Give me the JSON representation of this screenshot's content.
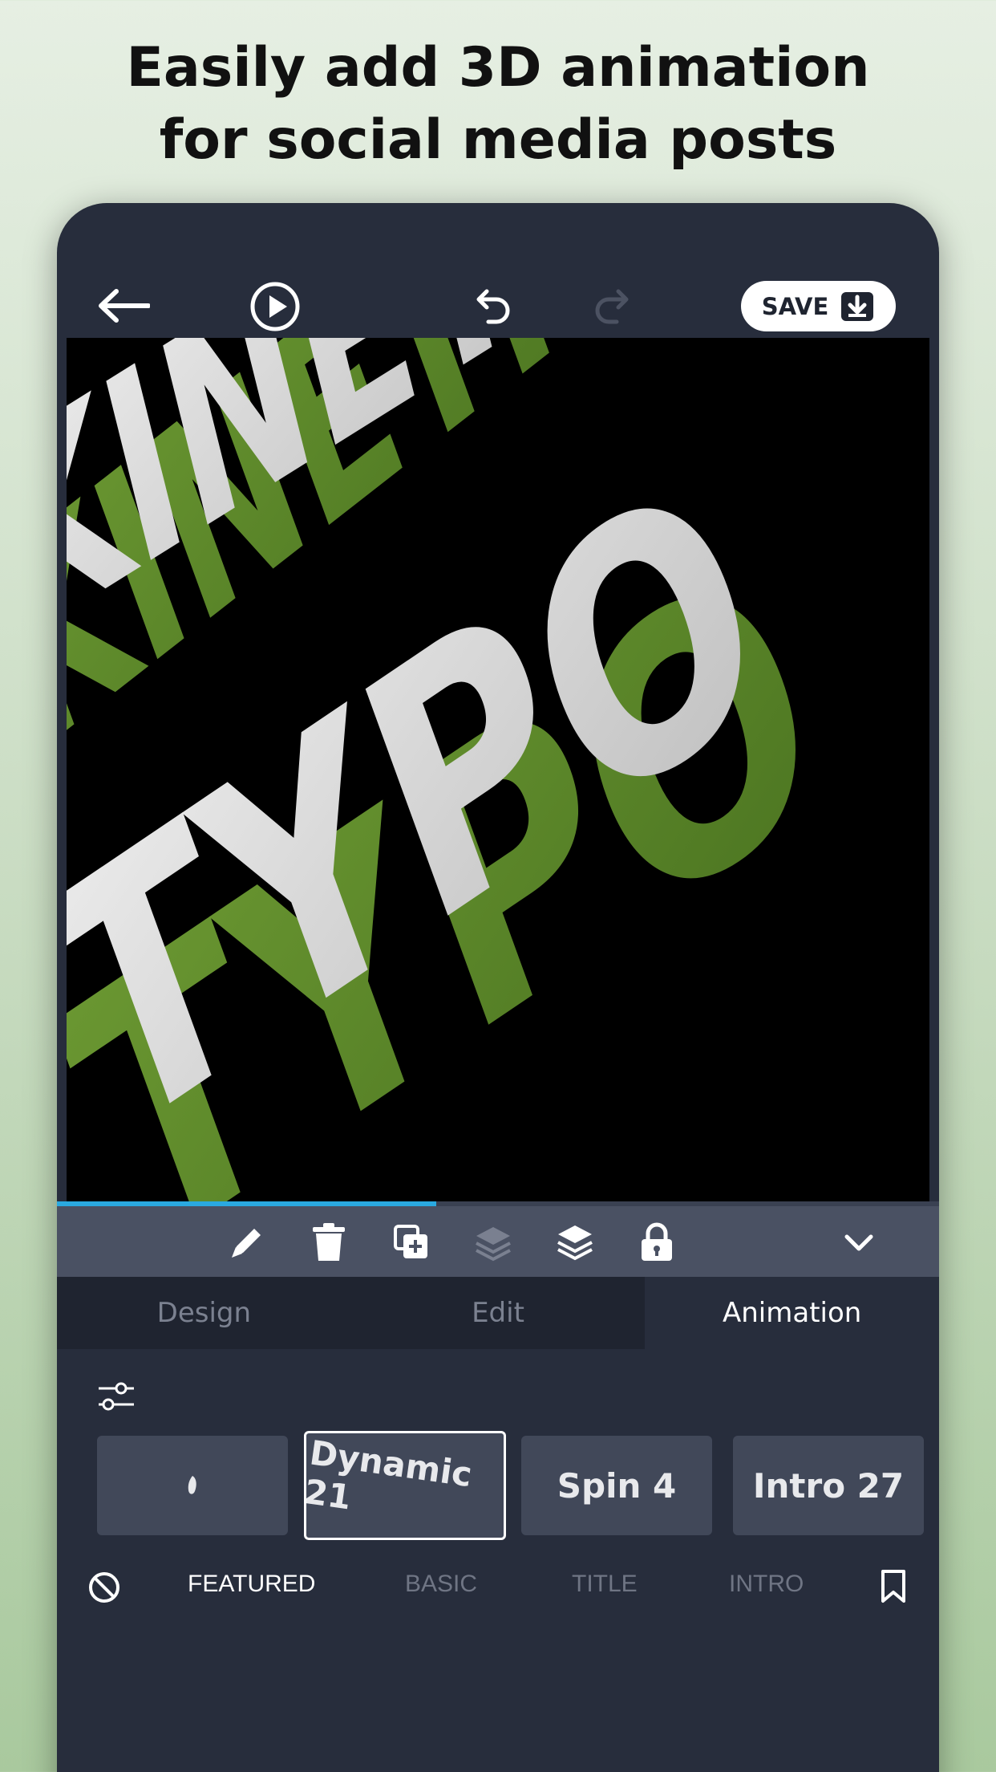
{
  "headline": {
    "line1": "Easily add 3D animation",
    "line2": "for social media posts"
  },
  "toolbar": {
    "back_icon": "arrow-left-icon",
    "play_icon": "play-circle-icon",
    "undo_icon": "undo-icon",
    "redo_icon": "redo-icon",
    "save_label": "SAVE",
    "save_icon": "download-icon"
  },
  "canvas": {
    "line1": "KINETIC",
    "line2": "TYPO",
    "colors": {
      "white": "#d9d9d9",
      "green": "#5a8428",
      "background": "#000000"
    }
  },
  "timeline": {
    "progress": 0.43,
    "color": "#2aa9e0"
  },
  "layer_tools": [
    {
      "name": "pencil-icon",
      "enabled": true
    },
    {
      "name": "trash-icon",
      "enabled": true
    },
    {
      "name": "duplicate-icon",
      "enabled": true
    },
    {
      "name": "layers-down-icon",
      "enabled": false
    },
    {
      "name": "layers-up-icon",
      "enabled": true
    },
    {
      "name": "lock-icon",
      "enabled": true
    },
    {
      "name": "chevron-down-icon",
      "enabled": true
    }
  ],
  "tabs": [
    {
      "label": "Design",
      "active": false
    },
    {
      "label": "Edit",
      "active": false
    },
    {
      "label": "Animation",
      "active": true
    }
  ],
  "presets": [
    {
      "label": "",
      "selected": false
    },
    {
      "label": "Dynamic 21",
      "selected": true
    },
    {
      "label": "Spin 4",
      "selected": false
    },
    {
      "label": "Intro 27",
      "selected": false
    }
  ],
  "categories": {
    "none_icon": "ban-icon",
    "bookmark_icon": "bookmark-icon",
    "items": [
      {
        "label": "FEATURED",
        "active": true
      },
      {
        "label": "BASIC",
        "active": false
      },
      {
        "label": "TITLE",
        "active": false
      },
      {
        "label": "INTRO",
        "active": false
      }
    ]
  }
}
